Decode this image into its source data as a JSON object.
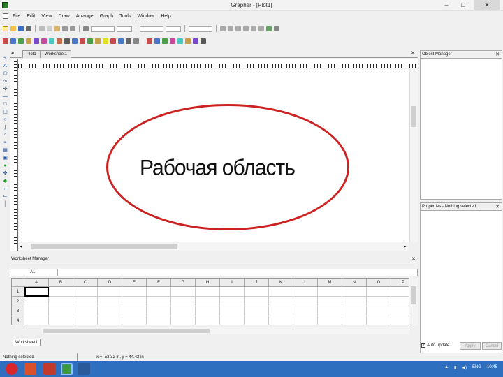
{
  "window": {
    "title": "Grapher - [Plot1]",
    "controls": {
      "minimize": "–",
      "maximize": "□",
      "close": "✕"
    }
  },
  "menu": [
    "File",
    "Edit",
    "View",
    "Draw",
    "Arrange",
    "Graph",
    "Tools",
    "Window",
    "Help"
  ],
  "document_tabs": [
    {
      "label": "Plot1",
      "active": true
    },
    {
      "label": "Worksheet1",
      "active": false
    }
  ],
  "canvas": {
    "annotation_text": "Рабочая область",
    "ellipse_color": "#cc2222"
  },
  "object_manager": {
    "title": "Object Manager",
    "close": "✕"
  },
  "property_manager": {
    "title": "Properties - Nothing selected",
    "close": "✕"
  },
  "worksheet_manager": {
    "title": "Worksheet Manager",
    "close": "✕",
    "cell_reference": "A1",
    "columns": [
      "A",
      "B",
      "C",
      "D",
      "E",
      "F",
      "G",
      "H",
      "I",
      "J",
      "K",
      "L",
      "M",
      "N",
      "O",
      "P"
    ],
    "rows": [
      "1",
      "2",
      "3",
      "4"
    ],
    "sheet_tab": "Worksheet1"
  },
  "properties_footer": {
    "auto_update_label": "Auto update",
    "auto_update_checked": "✓",
    "apply_label": "Apply",
    "cancel_label": "Cancel"
  },
  "statusbar": {
    "selection": "Nothing selected",
    "coordinates": "x = -53.32 in, y = 44.42 in"
  },
  "taskbar": {
    "language": "ENG",
    "time": "10:45"
  },
  "colors": {
    "taskbar": "#2f6fbf",
    "accent": "#cc2222"
  }
}
